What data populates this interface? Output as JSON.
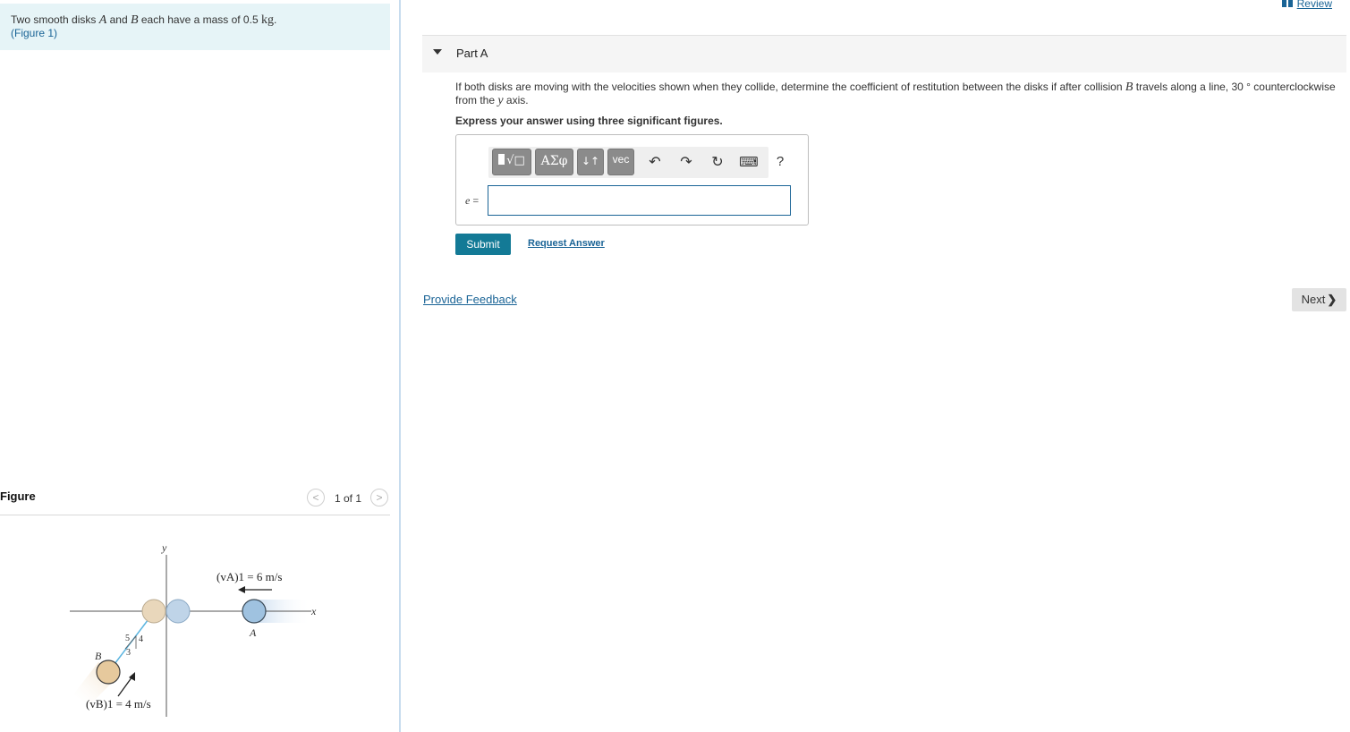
{
  "intro": {
    "text_before": "Two smooth disks ",
    "var_a": "A",
    "text_and": " and ",
    "var_b": "B",
    "text_mass": " each have a mass of 0.5 ",
    "unit": "kg",
    "text_end": ".",
    "figure_link": "(Figure 1)"
  },
  "figure": {
    "title": "Figure",
    "counter": "1 of 1",
    "prev_icon": "chevron-left-icon",
    "next_icon": "chevron-right-icon",
    "labels": {
      "y_axis": "y",
      "x_axis": "x",
      "va": "(vA)1 = 6 m/s",
      "vb": "(vB)1 = 4 m/s",
      "disk_a": "A",
      "disk_b": "B",
      "tri_5": "5",
      "tri_4": "4",
      "tri_3": "3"
    },
    "colors": {
      "disk_a": "#9fc2e0",
      "disk_b": "#e6c99d",
      "axis": "#555555"
    }
  },
  "review": {
    "label": "Review",
    "icon": "book-icon"
  },
  "part": {
    "title": "Part A",
    "caret_icon": "caret-down-icon"
  },
  "question": {
    "text1": "If both disks are moving with the velocities shown when they collide, determine the coefficient of restitution between the disks if after collision ",
    "var_b": "B",
    "text2": " travels along a line, 30 ° counterclockwise from the ",
    "var_y": "y",
    "text3": " axis."
  },
  "instruction": "Express your answer using three significant figures.",
  "toolbar": {
    "templates": "√□",
    "greek": "ΑΣφ",
    "arrows": "↓↑",
    "vec": "vec",
    "undo": "↶",
    "redo": "↷",
    "reset": "↻",
    "keyboard": "⌨",
    "help": "?"
  },
  "answer": {
    "variable": "e",
    "equals": " =",
    "value": ""
  },
  "buttons": {
    "submit": "Submit",
    "request_answer": "Request Answer",
    "provide_feedback": "Provide Feedback",
    "next": "Next",
    "next_icon": "chevron-right-icon"
  }
}
